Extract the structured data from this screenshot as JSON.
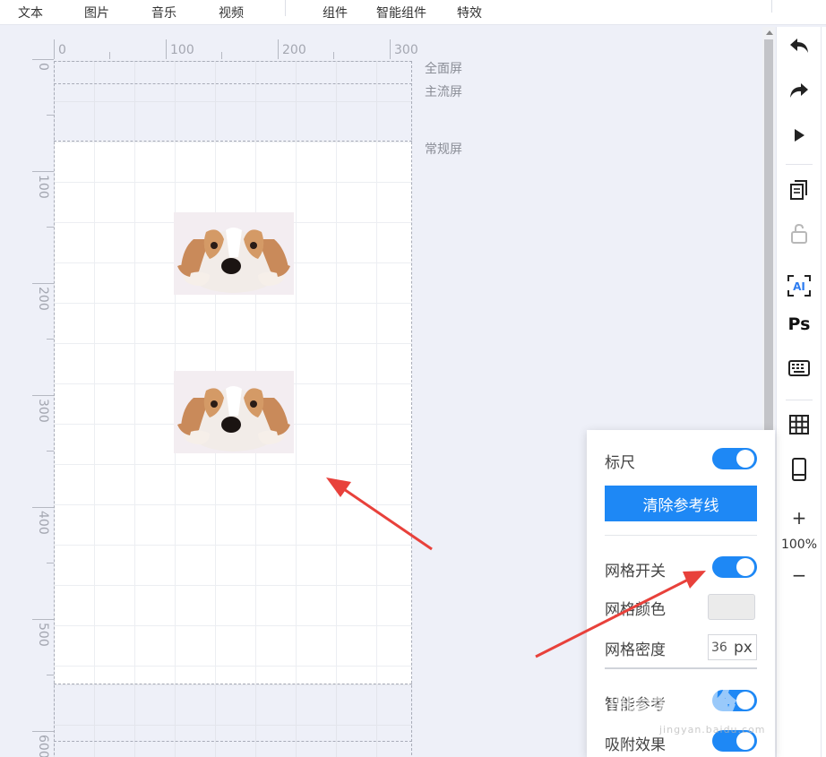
{
  "topbar": {
    "items": [
      "文本",
      "图片",
      "音乐",
      "视频",
      "组件",
      "智能组件",
      "特效"
    ]
  },
  "ruler": {
    "top_labels": [
      "0",
      "100",
      "200",
      "300"
    ],
    "left_labels": [
      "0",
      "100",
      "200",
      "300",
      "400",
      "500",
      "600"
    ]
  },
  "screen_labels": {
    "full": "全面屏",
    "mainstream": "主流屏",
    "regular": "常规屏"
  },
  "rightbar": {
    "zoom": "100%",
    "zoom_in": "+",
    "zoom_out": "−",
    "ai_label": "AI",
    "ps_label": "Ps"
  },
  "panel": {
    "ruler_label": "标尺",
    "ruler_on": true,
    "clear_guides": "清除参考线",
    "grid_switch_label": "网格开关",
    "grid_on": true,
    "grid_color_label": "网格颜色",
    "grid_color": "#ebebeb",
    "grid_density_label": "网格密度",
    "grid_density_value": "36",
    "grid_density_unit": "px",
    "smart_guide_label": "智能参考",
    "smart_guide_on": true,
    "snap_label": "吸附效果",
    "snap_on": true
  },
  "colors": {
    "accent": "#1e88f5",
    "arrow": "#e8413b"
  },
  "watermark": {
    "brand": "Bai 经验",
    "url": "jingyan.baidu.com"
  }
}
